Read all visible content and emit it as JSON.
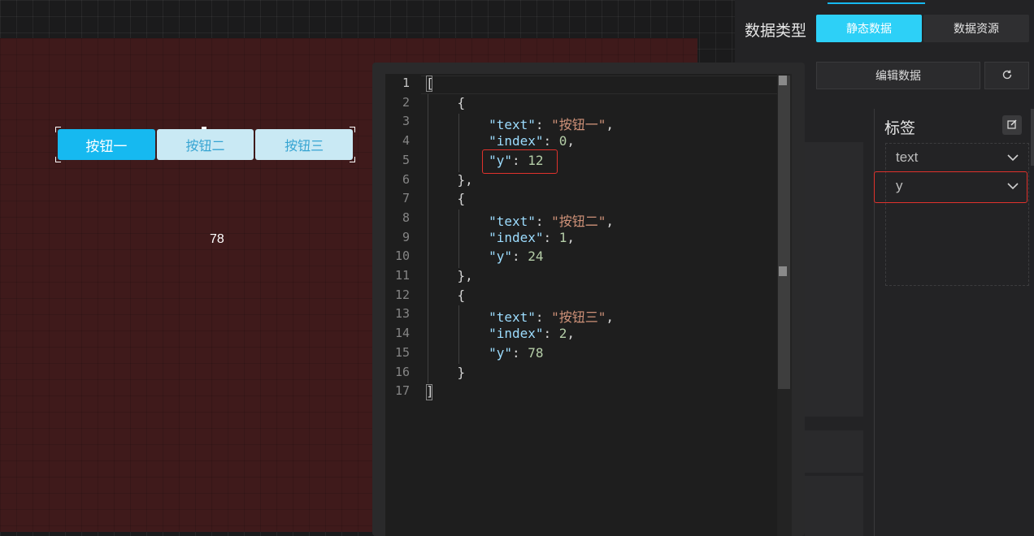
{
  "canvas": {
    "buttons": [
      {
        "label": "按钮一",
        "active": true
      },
      {
        "label": "按钮二",
        "active": false
      },
      {
        "label": "按钮三",
        "active": false
      }
    ],
    "value_text": "78"
  },
  "panel": {
    "data_type_label": "数据类型",
    "static_data_label": "静态数据",
    "data_resource_label": "数据资源",
    "edit_data_label": "编辑数据",
    "label_title": "标签",
    "fields": [
      {
        "name": "text"
      },
      {
        "name": "y"
      }
    ],
    "colors": {
      "accent": "#16b9f0",
      "highlight": "#e0322c"
    }
  },
  "editor": {
    "line_numbers": [
      "1",
      "2",
      "3",
      "4",
      "5",
      "6",
      "7",
      "8",
      "9",
      "10",
      "11",
      "12",
      "13",
      "14",
      "15",
      "16",
      "17"
    ],
    "current_line": 1,
    "code": [
      {
        "text": "按钮一",
        "index": 0,
        "y": 12
      },
      {
        "text": "按钮二",
        "index": 1,
        "y": 24
      },
      {
        "text": "按钮三",
        "index": 2,
        "y": 78
      }
    ]
  },
  "icons": [
    "refresh-icon",
    "edit-icon",
    "chevron-down-icon"
  ]
}
